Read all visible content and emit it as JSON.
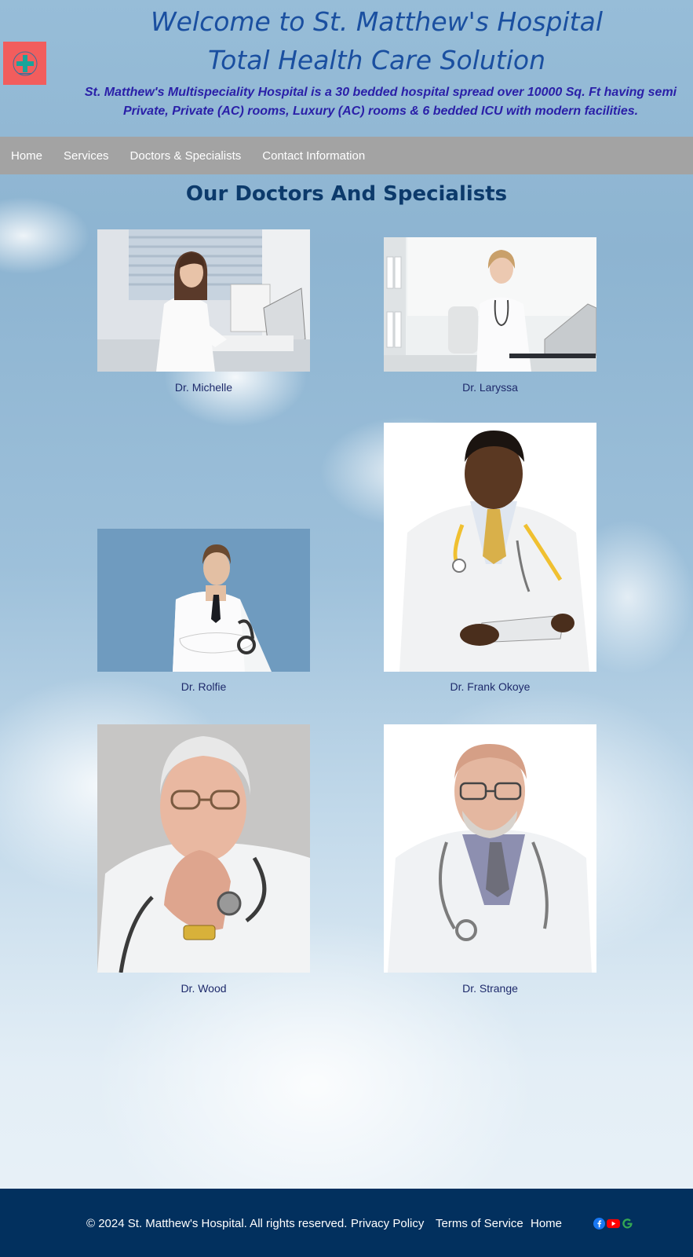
{
  "header": {
    "title_line1": "Welcome to St. Matthew's Hospital",
    "title_line2": "Total Health Care Solution",
    "intro": "St. Matthew's Multispeciality Hospital is a 30 bedded hospital spread over 10000 Sq. Ft having semi Private, Private (AC) rooms, Luxury (AC) rooms & 6 bedded ICU with modern facilities.",
    "logo_icon": "medical-cross-icon",
    "logo_color": "#f25d5d"
  },
  "nav": {
    "items": [
      {
        "label": "Home"
      },
      {
        "label": "Services"
      },
      {
        "label": "Doctors & Specialists"
      },
      {
        "label": "Contact Information"
      }
    ],
    "background": "#a3a3a3"
  },
  "main": {
    "heading": "Our Doctors And Specialists",
    "doctors": [
      {
        "name": "Dr. Michelle"
      },
      {
        "name": "Dr. Laryssa"
      },
      {
        "name": "Dr. Rolfie"
      },
      {
        "name": "Dr. Frank Okoye"
      },
      {
        "name": "Dr. Wood"
      },
      {
        "name": "Dr. Strange"
      }
    ]
  },
  "footer": {
    "copyright": "© 2024 St. Matthew's Hospital. All rights reserved.",
    "links": [
      {
        "label": "Privacy Policy"
      },
      {
        "label": "Terms of Service"
      },
      {
        "label": "Home"
      }
    ],
    "social": [
      {
        "icon": "facebook-icon",
        "color": "#1877f2"
      },
      {
        "icon": "youtube-icon",
        "color": "#ff0000"
      },
      {
        "icon": "google-icon",
        "color": "#34a853"
      }
    ],
    "background": "#02305e"
  }
}
